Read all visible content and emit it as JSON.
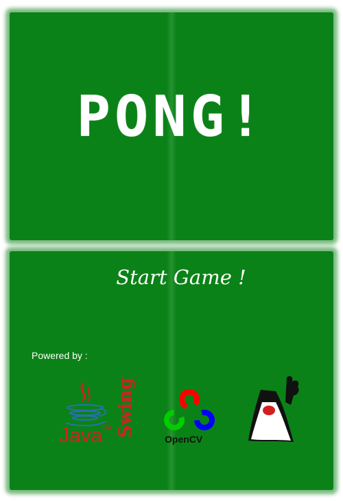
{
  "title": "PONG!",
  "start_button": "Start Game !",
  "powered_by": "Powered by :",
  "logos": {
    "java": {
      "text": "Java",
      "tm": "TM",
      "swing": "Swing"
    },
    "opencv": {
      "text": "OpenCV"
    },
    "duke": {
      "icon": "duke-mascot-icon"
    }
  },
  "colors": {
    "panel": "#0b8217",
    "java_red": "#cf2323",
    "opencv_red": "#ff0000",
    "opencv_green": "#00cc00",
    "opencv_blue": "#0000ff"
  }
}
